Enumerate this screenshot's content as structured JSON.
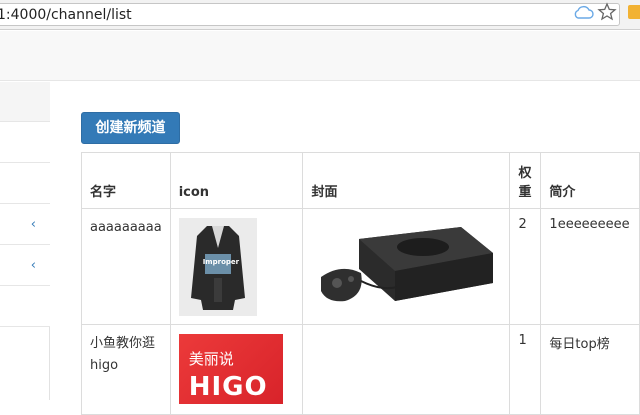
{
  "browser": {
    "url": "1:4000/channel/list",
    "icons": [
      "cloud-icon",
      "star-icon"
    ]
  },
  "sidebar": {
    "items": [
      {
        "chevron": ""
      },
      {
        "chevron": ""
      },
      {
        "chevron": ""
      },
      {
        "chevron": "‹"
      },
      {
        "chevron": "‹"
      },
      {
        "chevron": ""
      }
    ]
  },
  "toolbar": {
    "create_label": "创建新频道"
  },
  "table": {
    "headers": {
      "name": "名字",
      "icon": "icon",
      "cover": "封面",
      "weight": "权重",
      "desc": "简介"
    },
    "rows": [
      {
        "name": "aaaaaaaaa",
        "icon_image": "coat-product-photo",
        "icon_text": "Improper",
        "cover_image": "game-console-photo",
        "weight": "2",
        "desc": "1eeeeeeeee"
      },
      {
        "name": "小鱼教你逛higo",
        "icon_image": "higo-logo",
        "icon_text_line1": "美丽说",
        "icon_text_line2": "HIGO",
        "cover_image": "",
        "weight": "1",
        "desc": "每日top榜"
      }
    ]
  },
  "colors": {
    "primary": "#337ab7",
    "higo_red": "#e12d32"
  }
}
